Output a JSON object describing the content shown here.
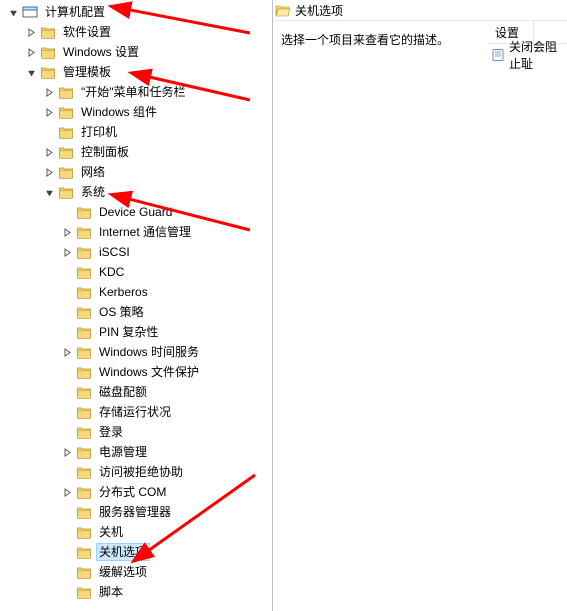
{
  "tree": {
    "root": "计算机配置",
    "nodes": [
      {
        "label": "软件设置",
        "indent": 1,
        "toggle": "closed",
        "icon": "folder"
      },
      {
        "label": "Windows 设置",
        "indent": 1,
        "toggle": "closed",
        "icon": "folder"
      },
      {
        "label": "管理模板",
        "indent": 1,
        "toggle": "open",
        "icon": "folder"
      },
      {
        "label": "\"开始\"菜单和任务栏",
        "indent": 2,
        "toggle": "closed",
        "icon": "folder"
      },
      {
        "label": "Windows 组件",
        "indent": 2,
        "toggle": "closed",
        "icon": "folder"
      },
      {
        "label": "打印机",
        "indent": 2,
        "toggle": "none",
        "icon": "folder"
      },
      {
        "label": "控制面板",
        "indent": 2,
        "toggle": "closed",
        "icon": "folder"
      },
      {
        "label": "网络",
        "indent": 2,
        "toggle": "closed",
        "icon": "folder"
      },
      {
        "label": "系统",
        "indent": 2,
        "toggle": "open",
        "icon": "folder"
      },
      {
        "label": "Device Guard",
        "indent": 3,
        "toggle": "none",
        "icon": "folder"
      },
      {
        "label": "Internet 通信管理",
        "indent": 3,
        "toggle": "closed",
        "icon": "folder"
      },
      {
        "label": "iSCSI",
        "indent": 3,
        "toggle": "closed",
        "icon": "folder"
      },
      {
        "label": "KDC",
        "indent": 3,
        "toggle": "none",
        "icon": "folder"
      },
      {
        "label": "Kerberos",
        "indent": 3,
        "toggle": "none",
        "icon": "folder"
      },
      {
        "label": "OS 策略",
        "indent": 3,
        "toggle": "none",
        "icon": "folder"
      },
      {
        "label": "PIN 复杂性",
        "indent": 3,
        "toggle": "none",
        "icon": "folder"
      },
      {
        "label": "Windows 时间服务",
        "indent": 3,
        "toggle": "closed",
        "icon": "folder"
      },
      {
        "label": "Windows 文件保护",
        "indent": 3,
        "toggle": "none",
        "icon": "folder"
      },
      {
        "label": "磁盘配额",
        "indent": 3,
        "toggle": "none",
        "icon": "folder"
      },
      {
        "label": "存储运行状况",
        "indent": 3,
        "toggle": "none",
        "icon": "folder"
      },
      {
        "label": "登录",
        "indent": 3,
        "toggle": "none",
        "icon": "folder"
      },
      {
        "label": "电源管理",
        "indent": 3,
        "toggle": "closed",
        "icon": "folder"
      },
      {
        "label": "访问被拒绝协助",
        "indent": 3,
        "toggle": "none",
        "icon": "folder"
      },
      {
        "label": "分布式 COM",
        "indent": 3,
        "toggle": "closed",
        "icon": "folder"
      },
      {
        "label": "服务器管理器",
        "indent": 3,
        "toggle": "none",
        "icon": "folder"
      },
      {
        "label": "关机",
        "indent": 3,
        "toggle": "none",
        "icon": "folder"
      },
      {
        "label": "关机选项",
        "indent": 3,
        "toggle": "none",
        "icon": "folder",
        "selected": true
      },
      {
        "label": "缓解选项",
        "indent": 3,
        "toggle": "none",
        "icon": "folder"
      },
      {
        "label": "脚本",
        "indent": 3,
        "toggle": "none",
        "icon": "folder"
      }
    ]
  },
  "detail": {
    "header_title": "关机选项",
    "description_prompt": "选择一个项目来查看它的描述。",
    "columns": {
      "setting": "设置"
    },
    "items": [
      {
        "label": "关闭会阻止耻"
      }
    ]
  }
}
